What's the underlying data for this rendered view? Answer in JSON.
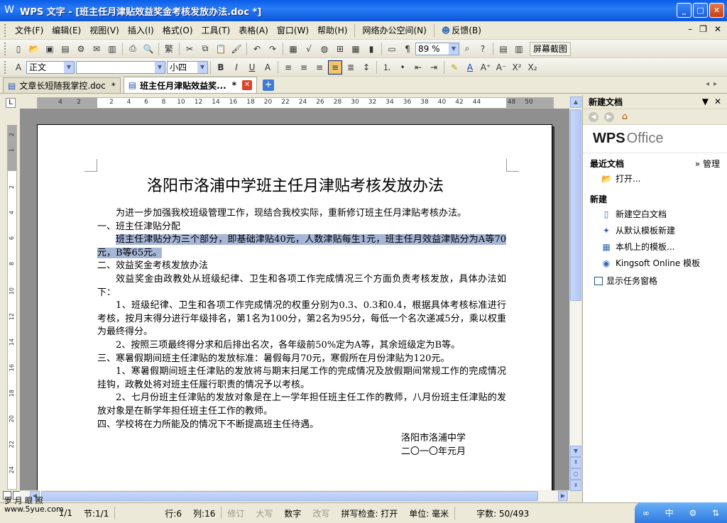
{
  "window": {
    "title": "WPS 文字 - [班主任月津贴效益奖金考核发放办法.doc *]"
  },
  "menu": {
    "items": [
      "文件(F)",
      "编辑(E)",
      "视图(V)",
      "插入(I)",
      "格式(O)",
      "工具(T)",
      "表格(A)",
      "窗口(W)",
      "帮助(H)"
    ],
    "network": "网络办公空间(N)",
    "feedback": "反馈(B)"
  },
  "toolbar": {
    "zoom": "89 %",
    "screenshot_label": "屏幕截图"
  },
  "format_toolbar": {
    "style": "正文",
    "font": "",
    "size": "小四"
  },
  "tabs": [
    {
      "label": "文章长短随我掌控.doc",
      "dirty": "*"
    },
    {
      "label": "班主任月津贴效益奖...",
      "dirty": "*"
    }
  ],
  "ruler": {
    "labels": [
      "4",
      "2",
      "2",
      "4",
      "6",
      "8",
      "10",
      "12",
      "14",
      "16",
      "18",
      "20",
      "22",
      "24",
      "26",
      "28",
      "30",
      "32",
      "34",
      "36",
      "38",
      "40",
      "42",
      "44",
      "48",
      "50"
    ]
  },
  "vruler": {
    "labels": [
      "2",
      "1",
      "2",
      "4",
      "6",
      "8",
      "10",
      "12",
      "14",
      "16",
      "18",
      "20",
      "22",
      "24"
    ]
  },
  "document": {
    "title": "洛阳市洛浦中学班主任月津贴考核发放办法",
    "paragraphs": [
      {
        "text": "为进一步加强我校班级管理工作，现结合我校实际，重新修订班主任月津贴考核办法。",
        "indent": true,
        "highlight": false
      },
      {
        "text": "一、班主任津贴分配",
        "indent": false,
        "highlight": false
      },
      {
        "text": "班主任津贴分为三个部分，即基础津贴40元，人数津贴每生1元，班主任月效益津贴分为A等70元，B等65元。",
        "indent": true,
        "highlight": true
      },
      {
        "text": "二、效益奖金考核发放办法",
        "indent": false,
        "highlight": false
      },
      {
        "text": "效益奖金由政教处从班级纪律、卫生和各项工作完成情况三个方面负责考核发放，具体办法如下：",
        "indent": true,
        "highlight": false
      },
      {
        "text": "1、班级纪律、卫生和各项工作完成情况的权重分别为0.3、0.3和0.4，根据具体考核标准进行考核，按月末得分进行年级排名，第1名为100分，第2名为95分，每低一个名次递减5分，乘以权重为最终得分。",
        "indent": true,
        "highlight": false
      },
      {
        "text": "2、按照三项最终得分求和后排出名次，各年级前50%定为A等，其余班级定为B等。",
        "indent": true,
        "highlight": false
      },
      {
        "text": "三、寒暑假期间班主任津贴的发放标准：暑假每月70元，寒假所在月份津贴为120元。",
        "indent": false,
        "highlight": false
      },
      {
        "text": "1、寒暑假期间班主任津贴的发放将与期末扫尾工作的完成情况及放假期间常规工作的完成情况挂钩，政教处将对班主任履行职责的情况予以考核。",
        "indent": true,
        "highlight": false
      },
      {
        "text": "2、七月份班主任津贴的发放对象是在上一学年担任班主任工作的教师，八月份班主任津贴的发放对象是在新学年担任班主任工作的教师。",
        "indent": true,
        "highlight": false
      },
      {
        "text": "四、学校将在力所能及的情况下不断提高班主任待遇。",
        "indent": false,
        "highlight": false
      }
    ],
    "signature": {
      "org": "洛阳市洛浦中学",
      "date": "二〇一〇年元月"
    }
  },
  "taskpane": {
    "title": "新建文档",
    "logo_bold": "WPS",
    "logo_rest": "Office",
    "recent_title": "最近文档",
    "manage": "» 管理",
    "open": "打开...",
    "new_title": "新建",
    "links": [
      "新建空白文档",
      "从默认模板新建",
      "本机上的模板...",
      "Kingsoft Online 模板"
    ],
    "show_pane": "显示任务窗格"
  },
  "status": {
    "page": "1/1",
    "section": "节:1/1",
    "row": "行:6",
    "col": "列:16",
    "rev": "修订",
    "caps": "大写",
    "num": "数字",
    "ovr": "改写",
    "spell": "拼写检查: 打开",
    "unit": "单位: 毫米",
    "words": "字数: 50/493",
    "watermark_top": "罗 月 眼 照",
    "watermark_bottom": "www.5yue.com"
  },
  "colors": {
    "titlebar": "#0a5de8",
    "selection": "#a6b6d6",
    "tray": "#2e7ae0"
  }
}
